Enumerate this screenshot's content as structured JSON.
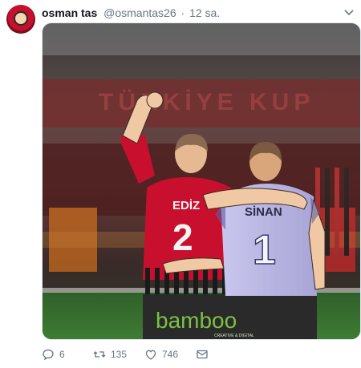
{
  "tweet": {
    "author_name": "osman tas",
    "handle": "@osmantas26",
    "separator": "·",
    "time": "12 sa.",
    "media": {
      "banner_text": "TÜRKİYE KUP",
      "players": [
        {
          "name": "EDİZ",
          "number": "2"
        },
        {
          "name": "SİNAN",
          "number": "1"
        }
      ],
      "brand": "bamboo",
      "brand_tagline": "CREATIVE & DIGITAL"
    },
    "actions": {
      "replies": "6",
      "retweets": "135",
      "likes": "746"
    }
  },
  "colors": {
    "icon_gray": "#657786",
    "jersey_red": "#c8102e",
    "jersey_lavender": "#b9b6e0",
    "brand_green": "#7bc043"
  }
}
